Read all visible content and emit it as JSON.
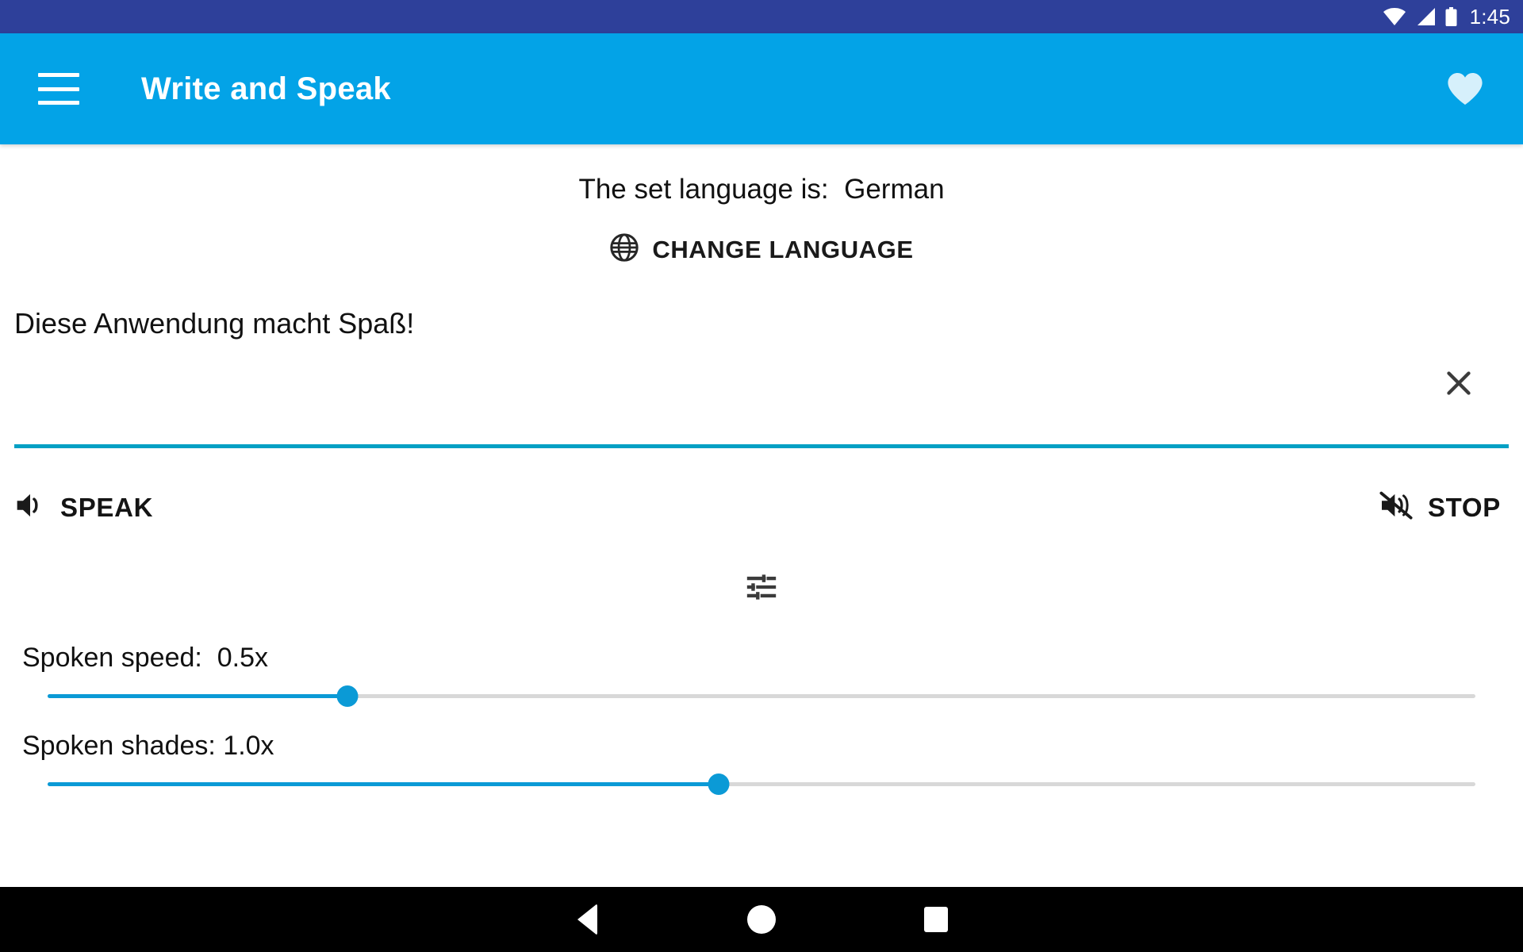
{
  "status_bar": {
    "time": "1:45",
    "background_color": "#2e409a",
    "icons": [
      "wifi-icon",
      "cellular-signal-icon",
      "battery-icon"
    ]
  },
  "app_bar": {
    "title": "Write and Speak",
    "background_color": "#03a3e7",
    "menu_icon": "hamburger-menu-icon",
    "favorite_icon": "heart-icon"
  },
  "main": {
    "language_status": "The set language is:  German",
    "change_language": {
      "label": "CHANGE LANGUAGE",
      "icon": "globe-icon"
    },
    "text_input": {
      "value": "Diese Anwendung macht Spaß!",
      "placeholder": "",
      "clear_icon": "close-x-icon",
      "underline_color": "#03a0c4"
    },
    "speak_button": {
      "label": "SPEAK",
      "icon": "volume-up-icon"
    },
    "stop_button": {
      "label": "STOP",
      "icon": "volume-off-icon"
    },
    "tune_button": {
      "icon": "tune-sliders-icon"
    },
    "sliders": [
      {
        "label": "Spoken speed:  0.5x",
        "value": "0.5x",
        "fill_percent": 21,
        "accent_color": "#0b9ad6"
      },
      {
        "label": "Spoken shades: 1.0x",
        "value": "1.0x",
        "fill_percent": 47,
        "accent_color": "#0b9ad6"
      }
    ]
  },
  "nav_bar": {
    "back": "back-triangle-icon",
    "home": "home-circle-icon",
    "recents": "recents-square-icon"
  }
}
